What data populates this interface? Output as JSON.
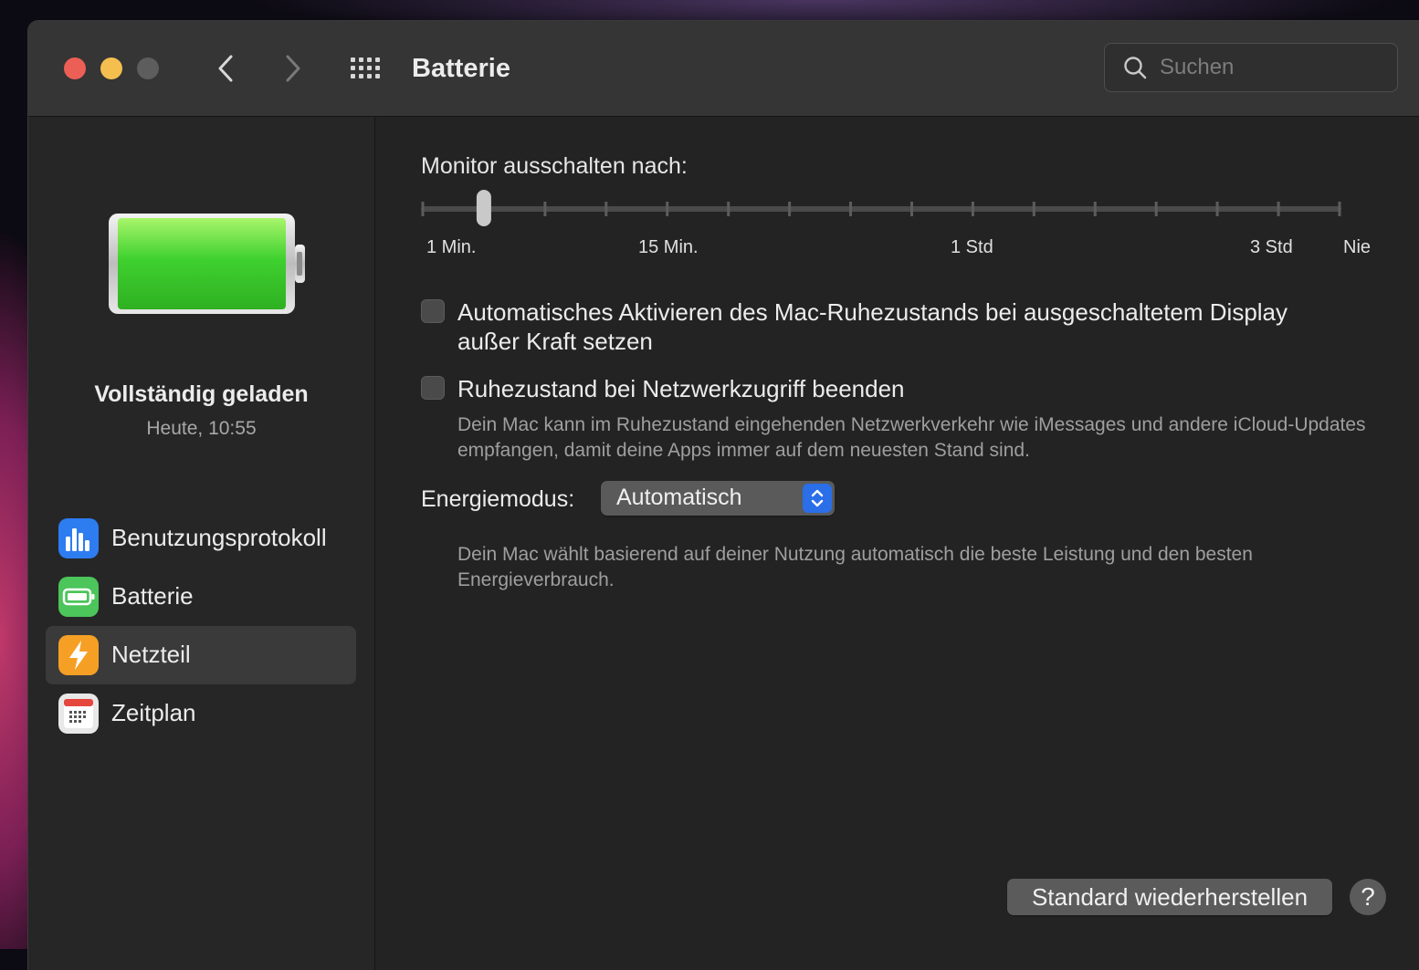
{
  "window": {
    "title": "Batterie"
  },
  "search": {
    "placeholder": "Suchen"
  },
  "sidebar": {
    "status_title": "Vollständig geladen",
    "status_time": "Heute, 10:55",
    "items": [
      {
        "label": "Benutzungsprotokoll",
        "icon": "bar-chart-icon",
        "selected": false
      },
      {
        "label": "Batterie",
        "icon": "battery-icon",
        "selected": false
      },
      {
        "label": "Netzteil",
        "icon": "lightning-icon",
        "selected": true
      },
      {
        "label": "Zeitplan",
        "icon": "calendar-icon",
        "selected": false
      }
    ]
  },
  "monitor_off": {
    "label": "Monitor ausschalten nach:",
    "tick_labels": [
      "1 Min.",
      "15 Min.",
      "1 Std",
      "3 Std",
      "Nie"
    ],
    "selected_index": 1,
    "tick_count": 16
  },
  "options": {
    "auto_sleep": {
      "label": "Automatisches Aktivieren des Mac-Ruhezustands bei ausgeschaltetem Display außer Kraft setzen",
      "checked": false
    },
    "wake_network": {
      "label": "Ruhezustand bei Netzwerkzugriff beenden",
      "checked": false,
      "description": "Dein Mac kann im Ruhezustand eingehenden Netzwerkverkehr wie iMessages und andere iCloud-Updates empfangen, damit deine Apps immer auf dem neuesten Stand sind."
    }
  },
  "energy": {
    "label": "Energiemodus:",
    "value": "Automatisch",
    "description": "Dein Mac wählt basierend auf deiner Nutzung automatisch die beste Leistung und den besten Energieverbrauch."
  },
  "footer": {
    "reset_label": "Standard wiederherstellen",
    "help_label": "?"
  },
  "colors": {
    "accent": "#2a6ee8",
    "battery_green": "#3fd12f",
    "close": "#ec5f57",
    "minimize": "#f4bf4f"
  }
}
